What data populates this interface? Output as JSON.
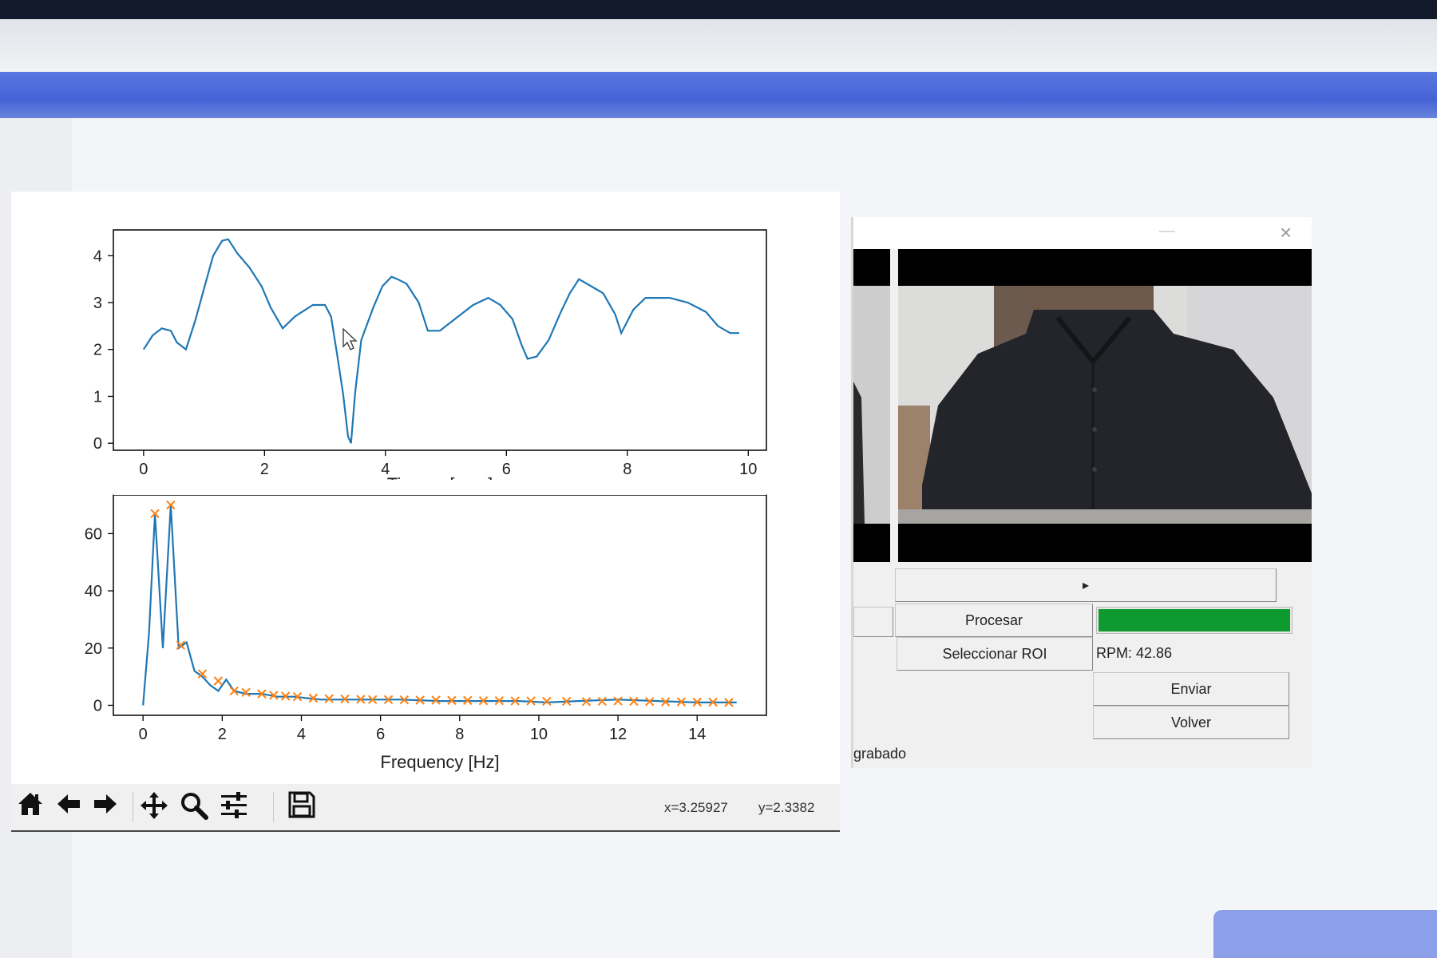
{
  "colors": {
    "line": "#1f77b4",
    "peaks": "#ff7f0e",
    "progress": "#0e9a2e"
  },
  "plot_window": {
    "toolbar": {
      "buttons": [
        {
          "id": "home",
          "icon": "home-icon"
        },
        {
          "id": "back",
          "icon": "arrow-left-icon"
        },
        {
          "id": "forward",
          "icon": "arrow-right-icon"
        },
        {
          "id": "pan",
          "icon": "pan-arrows-icon"
        },
        {
          "id": "zoom",
          "icon": "magnifier-icon"
        },
        {
          "id": "configure",
          "icon": "sliders-icon"
        },
        {
          "id": "save",
          "icon": "floppy-disk-icon"
        }
      ],
      "coord_x": "x=3.25927",
      "coord_y": "y=2.3382"
    }
  },
  "chart_data": [
    {
      "type": "line",
      "title": "",
      "xlabel": "Tiempo [seg.]",
      "ylabel": "",
      "xlim": [
        -0.5,
        10.3
      ],
      "ylim": [
        -0.15,
        4.55
      ],
      "xticks": [
        "0",
        "2",
        "4",
        "6",
        "8",
        "10"
      ],
      "yticks": [
        "0",
        "1",
        "2",
        "3",
        "4"
      ],
      "grid": false,
      "series": [
        {
          "x": [
            0,
            0.15,
            0.3,
            0.45,
            0.55,
            0.7,
            0.85,
            1.0,
            1.15,
            1.3,
            1.4,
            1.55,
            1.75,
            1.95,
            2.1,
            2.3,
            2.5,
            2.8,
            3.0,
            3.1,
            3.2,
            3.3,
            3.38,
            3.43,
            3.5,
            3.6,
            3.8,
            3.95,
            4.1,
            4.2,
            4.35,
            4.55,
            4.7,
            4.9,
            5.2,
            5.45,
            5.7,
            5.9,
            6.1,
            6.25,
            6.35,
            6.5,
            6.7,
            6.9,
            7.05,
            7.2,
            7.4,
            7.6,
            7.8,
            7.9,
            8.1,
            8.3,
            8.7,
            9.0,
            9.3,
            9.5,
            9.7,
            9.85
          ],
          "y": [
            2.0,
            2.3,
            2.45,
            2.4,
            2.15,
            2.0,
            2.6,
            3.3,
            4.0,
            4.32,
            4.35,
            4.05,
            3.75,
            3.35,
            2.9,
            2.45,
            2.7,
            2.95,
            2.95,
            2.7,
            1.9,
            1.05,
            0.15,
            0.0,
            1.1,
            2.2,
            2.9,
            3.35,
            3.55,
            3.5,
            3.4,
            3.0,
            2.4,
            2.4,
            2.7,
            2.95,
            3.1,
            2.95,
            2.65,
            2.1,
            1.8,
            1.85,
            2.2,
            2.8,
            3.2,
            3.5,
            3.35,
            3.2,
            2.75,
            2.35,
            2.85,
            3.1,
            3.1,
            3.0,
            2.8,
            2.5,
            2.35,
            2.35
          ]
        }
      ]
    },
    {
      "type": "line",
      "title": "",
      "xlabel": "Frequency [Hz]",
      "ylabel": "",
      "xlim": [
        -0.75,
        15.75
      ],
      "ylim": [
        -3.5,
        73.5
      ],
      "xticks": [
        "0",
        "2",
        "4",
        "6",
        "8",
        "10",
        "12",
        "14"
      ],
      "yticks": [
        "0",
        "20",
        "40",
        "60"
      ],
      "grid": false,
      "series": [
        {
          "x": [
            0,
            0.15,
            0.3,
            0.5,
            0.7,
            0.9,
            1.1,
            1.3,
            1.5,
            1.7,
            1.9,
            2.1,
            2.3,
            2.6,
            3.0,
            3.4,
            3.8,
            4.5,
            5.5,
            6.5,
            7.5,
            8.5,
            9.5,
            10.2,
            11.0,
            12.0,
            13.0,
            14.0,
            15.0
          ],
          "y": [
            0,
            25,
            67,
            20,
            70,
            20,
            22,
            12,
            10,
            7,
            5,
            9,
            5,
            4,
            4,
            3,
            3,
            2,
            2,
            2,
            1.5,
            1.5,
            1.5,
            1,
            1.5,
            2,
            1.5,
            1,
            1
          ]
        },
        {
          "name": "peaks",
          "x": [
            0.3,
            0.7,
            0.95,
            1.5,
            1.9,
            2.3,
            2.6,
            3.0,
            3.3,
            3.6,
            3.9,
            4.3,
            4.7,
            5.1,
            5.5,
            5.8,
            6.2,
            6.6,
            7.0,
            7.4,
            7.8,
            8.2,
            8.6,
            9.0,
            9.4,
            9.8,
            10.2,
            10.7,
            11.2,
            11.6,
            12.0,
            12.4,
            12.8,
            13.2,
            13.6,
            14.0,
            14.4,
            14.8
          ],
          "y": [
            67,
            70,
            21,
            11,
            8.5,
            5,
            4.5,
            4,
            3.5,
            3.2,
            3,
            2.5,
            2.3,
            2.2,
            2.1,
            2,
            2,
            1.9,
            1.8,
            1.8,
            1.7,
            1.7,
            1.6,
            1.6,
            1.5,
            1.5,
            1.4,
            1.4,
            1.3,
            1.4,
            1.5,
            1.4,
            1.3,
            1.2,
            1.2,
            1.1,
            1.1,
            1.0
          ]
        }
      ]
    }
  ],
  "video_window": {
    "buttons": {
      "play": "▸",
      "procesar": "Procesar",
      "seleccionar_roi": "Seleccionar ROI",
      "enviar": "Enviar",
      "volver": "Volver"
    },
    "progress": 1.0,
    "rpm_label": "RPM: 42.86",
    "status": "grabado"
  }
}
